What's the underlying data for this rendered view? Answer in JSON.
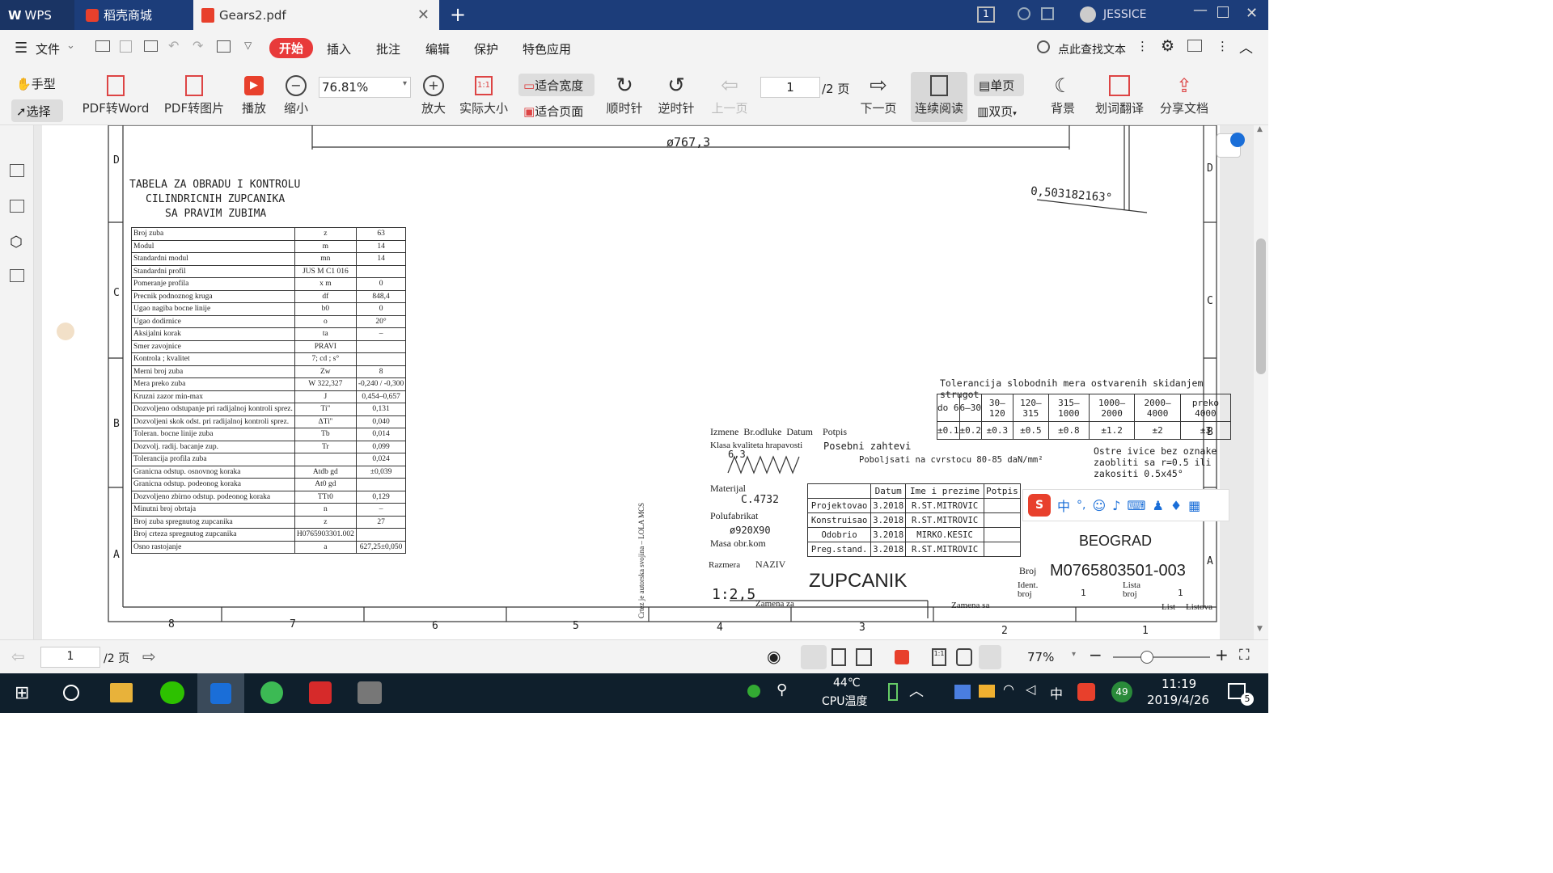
{
  "tabs": [
    {
      "label": "WPS"
    },
    {
      "label": "稻壳商城"
    },
    {
      "label": "Gears2.pdf"
    }
  ],
  "window": {
    "page_badge": "1",
    "user": "JESSICE"
  },
  "menu": {
    "file": "文件",
    "items": [
      "开始",
      "插入",
      "批注",
      "编辑",
      "保护",
      "特色应用"
    ],
    "search": "点此查找文本"
  },
  "toolbar": {
    "hand": "手型",
    "select": "选择",
    "pdf_word": "PDF转Word",
    "pdf_img": "PDF转图片",
    "play": "播放",
    "zoom_out": "缩小",
    "zoom": "76.81%",
    "zoom_in": "放大",
    "actual": "实际大小",
    "fit_width": "适合宽度",
    "fit_page": "适合页面",
    "cw": "顺时针",
    "ccw": "逆时针",
    "prev": "上一页",
    "page": "1",
    "page_total": "/2 页",
    "next": "下一页",
    "continuous": "连续阅读",
    "single": "单页",
    "double": "双页",
    "bg": "背景",
    "translate": "划词翻译",
    "share": "分享文档"
  },
  "drawing": {
    "dim_top": "ø767,3",
    "dim_angle": "0,503182163°",
    "title1": "TABELA ZA OBRADU I KONTROLU",
    "title2": "CILINDRICNIH ZUPCANIKA",
    "title3": "SA PRAVIM ZUBIMA",
    "zones_left": [
      "D",
      "C",
      "B",
      "A"
    ],
    "zones_right": [
      "D",
      "C",
      "B",
      "A"
    ],
    "cols": [
      "8",
      "7",
      "6",
      "5",
      "4",
      "3",
      "2",
      "1"
    ],
    "gear_rows": [
      [
        "Broj zuba",
        "z",
        "63"
      ],
      [
        "Modul",
        "m",
        "14"
      ],
      [
        "Standardni modul",
        "mn",
        "14"
      ],
      [
        "Standardni profil",
        "JUS M C1 016",
        ""
      ],
      [
        "Pomeranje profila",
        "x m",
        "0"
      ],
      [
        "Precnik podnoznog kruga",
        "df",
        "848,4"
      ],
      [
        "Ugao nagiba bocne linije",
        "b0",
        "0"
      ],
      [
        "Ugao dodirnice",
        "o",
        "20°"
      ],
      [
        "Aksijalni korak",
        "ta",
        "–"
      ],
      [
        "Smer zavojnice",
        "PRAVI",
        ""
      ],
      [
        "Kontrola ; kvalitet",
        "7; cd ; s°",
        ""
      ],
      [
        "Merni broj zuba",
        "Zw",
        "8"
      ],
      [
        "Mera preko zuba",
        "W 322,327",
        "-0,240 / -0,300"
      ],
      [
        "Kruzni zazor min-max",
        "J",
        "0,454–0,657"
      ],
      [
        "Dozvoljeno odstupanje pri radijalnoj kontroli sprez.",
        "Ti''",
        "0,131"
      ],
      [
        "Dozvoljeni skok odst. pri radijalnoj kontroli sprez.",
        "ΔTi''",
        "0,040"
      ],
      [
        "Toleran. bocne linije zuba",
        "Tb",
        "0,014"
      ],
      [
        "Dozvolj. radij. bacanje zup.",
        "Tr",
        "0,099"
      ],
      [
        "Tolerancija profila zuba",
        "",
        "0,024"
      ],
      [
        "Granicna odstup. osnovnog koraka",
        "Atdb gd",
        "±0,039"
      ],
      [
        "Granicna odstup. podeonog koraka",
        "At0 gd",
        ""
      ],
      [
        "Dozvoljeno zbirno odstup. podeonog koraka",
        "TTt0",
        "0,129"
      ],
      [
        "Minutni broj obrtaja",
        "n",
        "–"
      ],
      [
        "Broj zuba spregnutog zupcanika",
        "z",
        "27"
      ],
      [
        "Broj crteza spregnutog zupcanika",
        "H0765903301.002",
        ""
      ],
      [
        "Osno rastojanje",
        "a",
        "627,25±0,050"
      ]
    ],
    "tol_title": "Tolerancija slobodnih mera ostvarenih skidanjem strugot",
    "tol_ranges": [
      "do 6",
      "6–30",
      "30–120",
      "120–315",
      "315–1000",
      "1000–2000",
      "2000–4000",
      "preko 4000"
    ],
    "tol_values": [
      "±0.1",
      "±0.2",
      "±0.3",
      "±0.5",
      "±0.8",
      "±1.2",
      "±2",
      "±3"
    ],
    "rev_headers": [
      "Izmene",
      "Br.odluke",
      "Datum",
      "Potpis"
    ],
    "roughness_label": "Klasa kvaliteta hrapavosti",
    "roughness": "6,3",
    "special_label": "Posebni zahtevi",
    "special": "Poboljsati na cvrstocu 80-85 daN/mm²",
    "edges": "Ostre ivice bez oznake zaobliti sa r=0.5 ili zakositi 0.5x45°",
    "material_label": "Materijal",
    "material": "C.4732",
    "semi_label": "Polufabrikat",
    "semi": "ø920X90",
    "mass_label": "Masa obr.kom",
    "sig_headers": [
      "Datum",
      "Ime i prezime",
      "Potpis"
    ],
    "sig_rows": [
      [
        "Projektovao",
        "3.2018",
        "R.ST.MITROVIC"
      ],
      [
        "Konstruisao",
        "3.2018",
        "R.ST.MITROVIC"
      ],
      [
        "Odobrio",
        "3.2018",
        "MIRKO.KESIC"
      ],
      [
        "Preg.stand.",
        "3.2018",
        "R.ST.MITROVIC"
      ]
    ],
    "city": "BEOGRAD",
    "scale_label": "Razmera",
    "scale": "1:2,5",
    "name_label": "NAZIV",
    "name": "ZUPCANIK",
    "num_label": "Broj",
    "num": "M0765803501-003",
    "ident_label": "Ident. broj",
    "ident": "1",
    "lista_label": "Lista broj",
    "lista": "1",
    "list_label": "List",
    "listova_label": "Listova",
    "zamena_za": "Zamena za",
    "zamena_sa": "Zamena sa",
    "copyright": "Crtez je autorska svojina – LOLA MCS"
  },
  "ime": {
    "label": "中"
  },
  "status": {
    "page": "1",
    "total": "/2 页",
    "zoom": "77%"
  },
  "tray": {
    "temp": "44℃",
    "temp_label": "CPU温度",
    "lang": "中",
    "badge": "49",
    "time": "11:19",
    "date": "2019/4/26",
    "notif": "5"
  },
  "colors": {
    "tabbar": "#1c3d7a",
    "accent": "#e83a3a",
    "taskbar": "#0f1f2c"
  }
}
